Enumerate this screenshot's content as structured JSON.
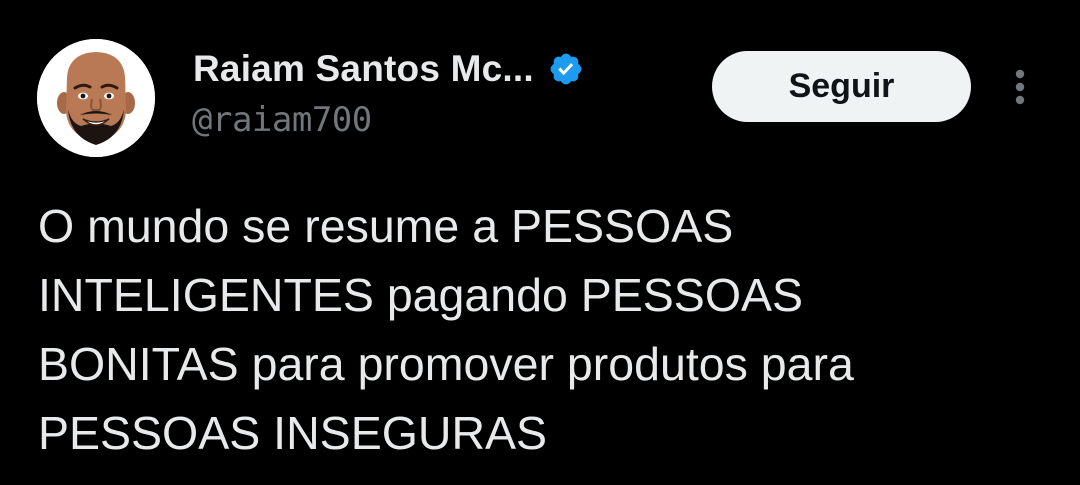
{
  "author": {
    "display_name": "Raiam Santos Mc...",
    "handle": "@raiam700",
    "verified": true,
    "avatar": "cartoon-portrait-avatar"
  },
  "actions": {
    "follow_label": "Seguir",
    "more_icon": "more-vertical-icon"
  },
  "tweet": {
    "text": "O mundo se resume a PESSOAS\nINTELIGENTES pagando PESSOAS\nBONITAS para promover produtos para\nPESSOAS INSEGURAS"
  },
  "colors": {
    "background": "#000000",
    "text_primary": "#e7e9ea",
    "text_secondary": "#71767b",
    "verified_blue": "#1d9bf0",
    "button_bg": "#eff3f4",
    "button_text": "#0f1419"
  }
}
